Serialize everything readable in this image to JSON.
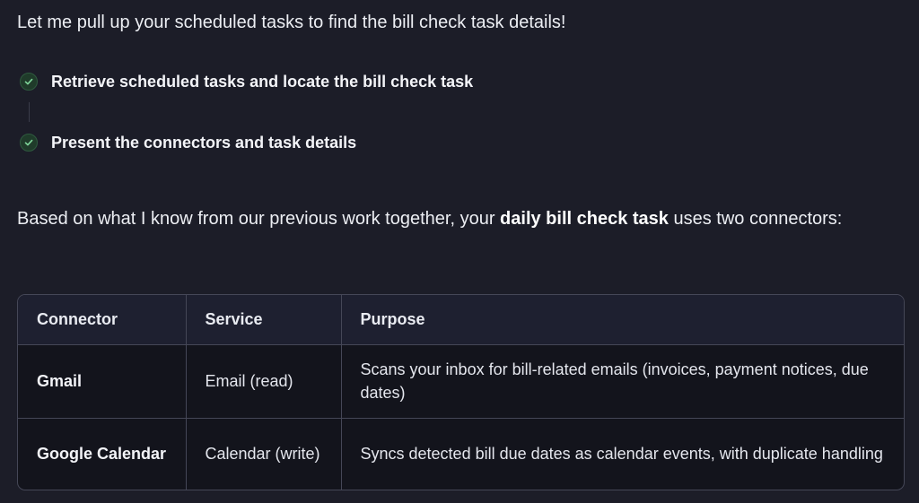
{
  "intro": "Let me pull up your scheduled tasks to find the bill check task details!",
  "steps": [
    {
      "label": "Retrieve scheduled tasks and locate the bill check task",
      "status": "done"
    },
    {
      "label": "Present the connectors and task details",
      "status": "done"
    }
  ],
  "summary": {
    "prefix": "Based on what I know from our previous work together, your ",
    "bold": "daily bill check task",
    "suffix": " uses two connectors:"
  },
  "table": {
    "headers": [
      "Connector",
      "Service",
      "Purpose"
    ],
    "rows": [
      [
        "Gmail",
        "Email (read)",
        "Scans your inbox for bill-related emails (invoices, payment notices, due dates)"
      ],
      [
        "Google Calendar",
        "Calendar (write)",
        "Syncs detected bill due dates as calendar events, with duplicate handling"
      ]
    ]
  },
  "colors": {
    "background": "#1c1d28",
    "check_bg": "#1f3b2a",
    "check_mark": "#7fd69a",
    "table_border": "#454757",
    "header_bg": "#1e2030"
  },
  "icons": [
    "check-circle-icon"
  ]
}
